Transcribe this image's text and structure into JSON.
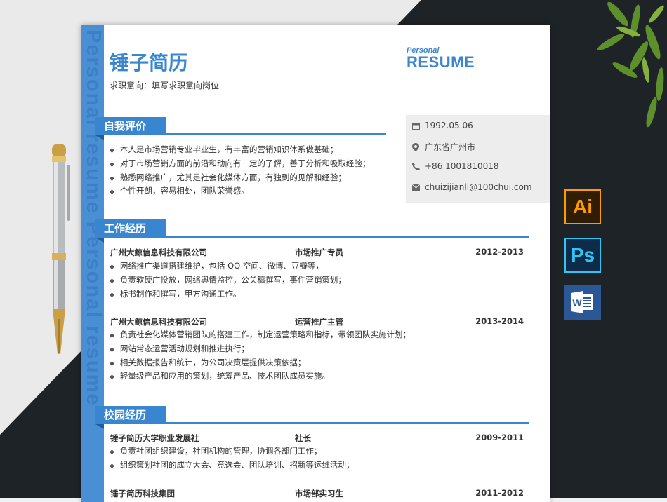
{
  "name": "锤子简历",
  "intent": "求职意向：填写求职意向岗位",
  "logo": {
    "small": "Personal",
    "big": "RESUME"
  },
  "stripe_text": "Personal resume Personal resume",
  "contact": {
    "birthday": "1992.05.06",
    "location": "广东省广州市",
    "phone": "+86 1001810018",
    "email": "chuizijianli@100chui.com"
  },
  "sections": {
    "self": {
      "title": "自我评价",
      "items": [
        "本人是市场营销专业毕业生，有丰富的营销知识体系做基础；",
        "对于市场营销方面的前沿和动向有一定的了解，善于分析和吸取经验；",
        "熟悉网络推广，尤其是社会化媒体方面，有独到的见解和经验；",
        "个性开朗，容易相处，团队荣誉感。"
      ]
    },
    "work": {
      "title": "工作经历",
      "jobs": [
        {
          "company": "广州大鲸信息科技有限公司",
          "role": "市场推广专员",
          "years": "2012-2013",
          "items": [
            "网络推广渠道搭建维护，包括 QQ 空间、微博、豆瓣等，",
            "负责软硬广投放，网络舆情监控，公关稿撰写，事件营销策划；",
            "标书制作和撰写，甲方沟通工作。"
          ]
        },
        {
          "company": "广州大鲸信息科技有限公司",
          "role": "运营推广主管",
          "years": "2013-2014",
          "items": [
            "负责社会化媒体营销团队的搭建工作，制定运营策略和指标，带领团队实施计划；",
            "网站常态运营活动规划和推进执行；",
            "相关数据报告和统计，为公司决策层提供决策依据；",
            "轻量级产品和应用的策划，统筹产品、技术团队成员实施。"
          ]
        }
      ]
    },
    "campus": {
      "title": "校园经历",
      "jobs": [
        {
          "company": "锤子简历大学职业发展社",
          "role": "社长",
          "years": "2009-2011",
          "items": [
            "负责社团组织建设，社团机构的管理，协调各部门工作；",
            "组织策划社团的成立大会、竞选会、团队培训、招新等运维活动；"
          ]
        },
        {
          "company": "锤子简历科技集团",
          "role": "市场部实习生",
          "years": "2011-2012",
          "items": []
        }
      ]
    }
  },
  "apps": {
    "ai": "Ai",
    "ps": "Ps",
    "word": "W"
  },
  "colors": {
    "accent": "#3a85cf",
    "stripe": "#4a8fd4",
    "background_dark": "#1e2327"
  }
}
